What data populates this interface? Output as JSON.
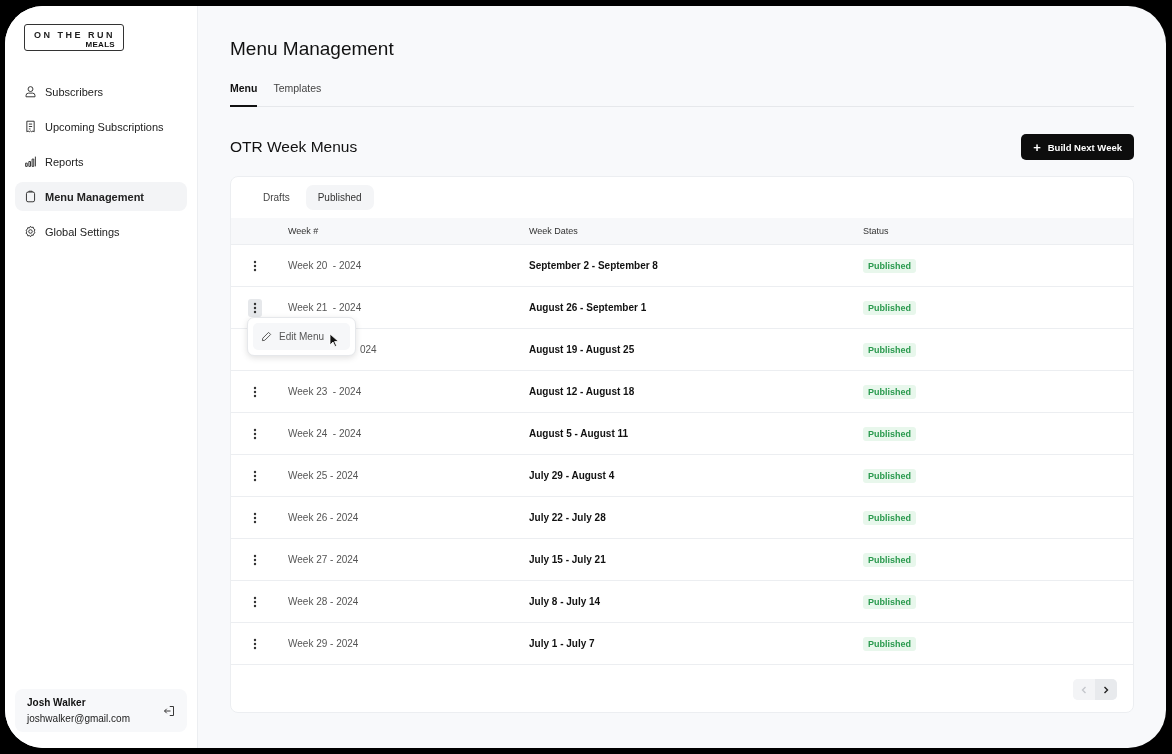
{
  "sidebar": {
    "logo": {
      "line1": "ON THE RUN",
      "line2": "MEALS"
    },
    "items": [
      {
        "label": "Subscribers",
        "selected": false
      },
      {
        "label": "Upcoming Subscriptions",
        "selected": false
      },
      {
        "label": "Reports",
        "selected": false
      },
      {
        "label": "Menu Management",
        "selected": true
      },
      {
        "label": "Global Settings",
        "selected": false
      }
    ],
    "user": {
      "name": "Josh Walker",
      "email": "joshwalker@gmail.com"
    }
  },
  "page_title": "Menu Management",
  "tabs": [
    {
      "label": "Menu",
      "selected": true
    },
    {
      "label": "Templates",
      "selected": false
    }
  ],
  "section_title": "OTR Week Menus",
  "build_button": {
    "icon": "+",
    "label": "Build Next Week"
  },
  "filter_tabs": [
    {
      "label": "Drafts",
      "selected": false
    },
    {
      "label": "Published",
      "selected": true
    }
  ],
  "table": {
    "columns": [
      "Week #",
      "Week Dates",
      "Status"
    ],
    "rows": [
      {
        "week": "Week 20  - 2024",
        "dates": "September 2 - September 8",
        "status": "Published",
        "menu_open": false
      },
      {
        "week": "Week 21  - 2024",
        "dates": "August 26 - September 1",
        "status": "Published",
        "menu_open": true
      },
      {
        "week": "024",
        "dates": "August 19 - August 25",
        "status": "Published",
        "menu_open": false
      },
      {
        "week": "Week 23  - 2024",
        "dates": "August 12 - August 18",
        "status": "Published",
        "menu_open": false
      },
      {
        "week": "Week 24  - 2024",
        "dates": "August 5 - August 11",
        "status": "Published",
        "menu_open": false
      },
      {
        "week": "Week 25 - 2024",
        "dates": "July 29 - August 4",
        "status": "Published",
        "menu_open": false
      },
      {
        "week": "Week 26 - 2024",
        "dates": "July 22 - July 28",
        "status": "Published",
        "menu_open": false
      },
      {
        "week": "Week 27 - 2024",
        "dates": "July 15 - July 21",
        "status": "Published",
        "menu_open": false
      },
      {
        "week": "Week 28 - 2024",
        "dates": "July 8 - July 14",
        "status": "Published",
        "menu_open": false
      },
      {
        "week": "Week 29 - 2024",
        "dates": "July 1 - July 7",
        "status": "Published",
        "menu_open": false
      }
    ]
  },
  "row_menu": {
    "label": "Edit Menu"
  },
  "pagination": {
    "prev_disabled": true,
    "next_disabled": false
  }
}
